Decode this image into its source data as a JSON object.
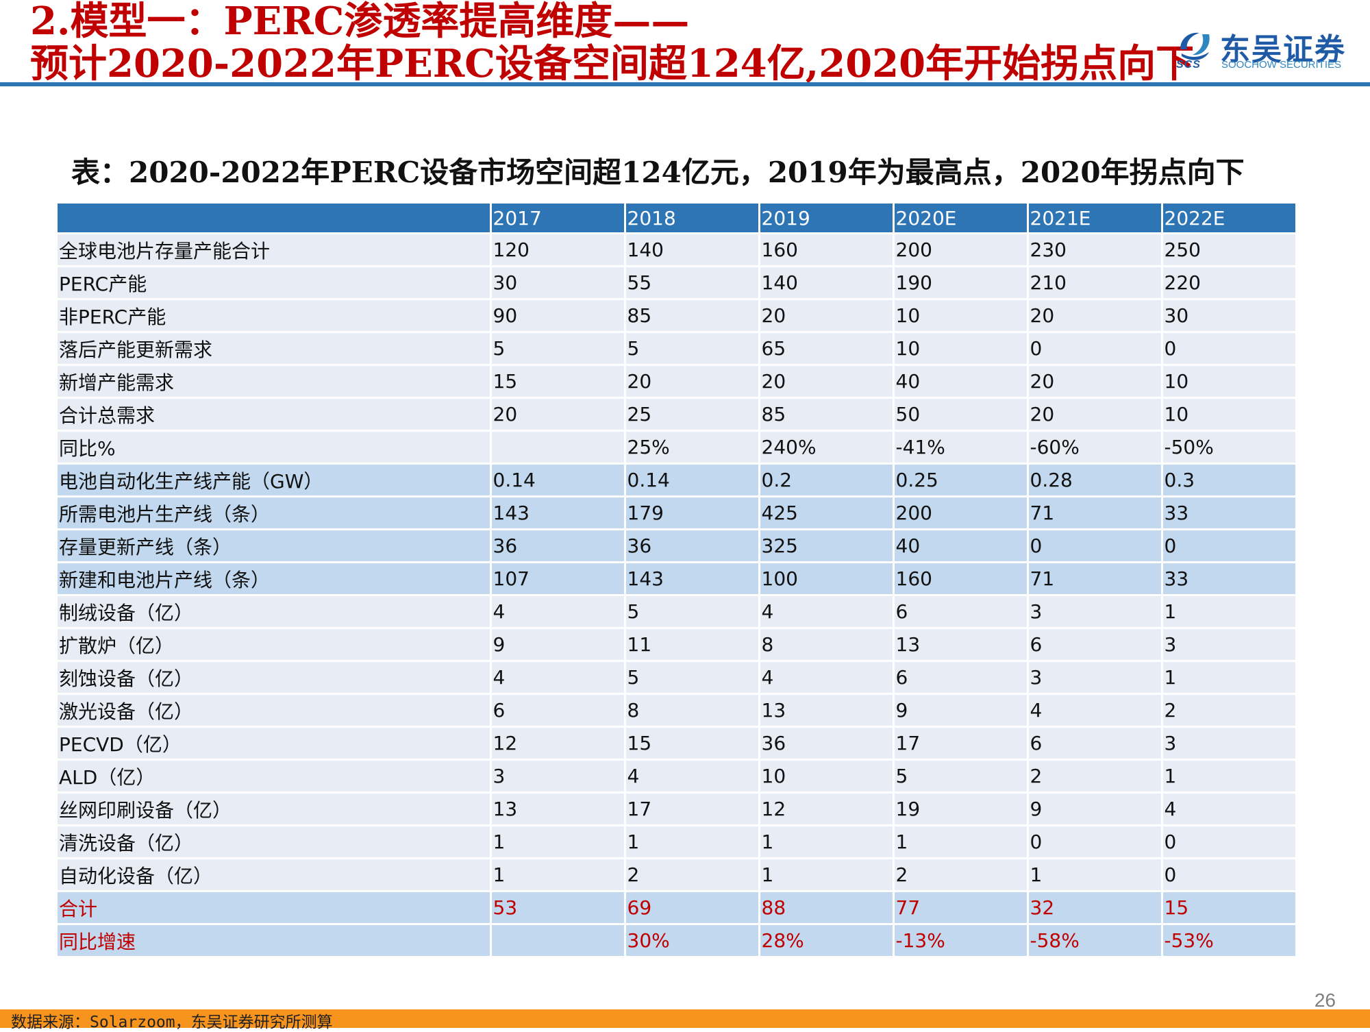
{
  "header": {
    "title_line1": "2.模型一：PERC渗透率提高维度——",
    "title_line2": "预计2020-2022年PERC设备空间超124亿,2020年开始拐点向下"
  },
  "logo": {
    "name_cn": "东吴证券",
    "name_en": "SOOCHOW SECURITIES",
    "abbr": "SCS",
    "brand_color": "#1f5aa6"
  },
  "table_title": "表：2020-2022年PERC设备市场空间超124亿元，2019年为最高点，2020年拐点向下",
  "table": {
    "header": [
      "",
      "2017",
      "2018",
      "2019",
      "2020E",
      "2021E",
      "2022E"
    ],
    "rows": [
      {
        "style": "light",
        "cells": [
          "全球电池片存量产能合计",
          "120",
          "140",
          "160",
          "200",
          "230",
          "250"
        ]
      },
      {
        "style": "light",
        "cells": [
          "PERC产能",
          "30",
          "55",
          "140",
          "190",
          "210",
          "220"
        ]
      },
      {
        "style": "light",
        "cells": [
          "非PERC产能",
          "90",
          "85",
          "20",
          "10",
          "20",
          "30"
        ]
      },
      {
        "style": "light",
        "cells": [
          "落后产能更新需求",
          "5",
          "5",
          "65",
          "10",
          "0",
          "0"
        ]
      },
      {
        "style": "light",
        "cells": [
          "新增产能需求",
          "15",
          "20",
          "20",
          "40",
          "20",
          "10"
        ]
      },
      {
        "style": "light",
        "cells": [
          "合计总需求",
          "20",
          "25",
          "85",
          "50",
          "20",
          "10"
        ]
      },
      {
        "style": "light",
        "cells": [
          "同比%",
          "",
          "25%",
          "240%",
          "-41%",
          "-60%",
          "-50%"
        ]
      },
      {
        "style": "blue",
        "cells": [
          "电池自动化生产线产能（GW）",
          "0.14",
          "0.14",
          "0.2",
          "0.25",
          "0.28",
          "0.3"
        ]
      },
      {
        "style": "blue",
        "cells": [
          "所需电池片生产线（条）",
          "143",
          "179",
          "425",
          "200",
          "71",
          "33"
        ]
      },
      {
        "style": "blue",
        "cells": [
          "存量更新产线（条）",
          "36",
          "36",
          "325",
          "40",
          "0",
          "0"
        ]
      },
      {
        "style": "blue",
        "cells": [
          "新建和电池片产线（条）",
          "107",
          "143",
          "100",
          "160",
          "71",
          "33"
        ]
      },
      {
        "style": "light",
        "cells": [
          "制绒设备（亿）",
          "4",
          "5",
          "4",
          "6",
          "3",
          "1"
        ]
      },
      {
        "style": "light",
        "cells": [
          "扩散炉（亿）",
          "9",
          "11",
          "8",
          "13",
          "6",
          "3"
        ]
      },
      {
        "style": "light",
        "cells": [
          "刻蚀设备（亿）",
          "4",
          "5",
          "4",
          "6",
          "3",
          "1"
        ]
      },
      {
        "style": "light",
        "cells": [
          "激光设备（亿）",
          "6",
          "8",
          "13",
          "9",
          "4",
          "2"
        ]
      },
      {
        "style": "light",
        "cells": [
          "PECVD（亿）",
          "12",
          "15",
          "36",
          "17",
          "6",
          "3"
        ]
      },
      {
        "style": "light",
        "cells": [
          "ALD（亿）",
          "3",
          "4",
          "10",
          "5",
          "2",
          "1"
        ]
      },
      {
        "style": "light",
        "cells": [
          "丝网印刷设备（亿）",
          "13",
          "17",
          "12",
          "19",
          "9",
          "4"
        ]
      },
      {
        "style": "light",
        "cells": [
          "清洗设备（亿）",
          "1",
          "1",
          "1",
          "1",
          "0",
          "0"
        ]
      },
      {
        "style": "light",
        "cells": [
          "自动化设备（亿）",
          "1",
          "2",
          "1",
          "2",
          "1",
          "0"
        ]
      },
      {
        "style": "blue total",
        "cells": [
          "合计",
          "53",
          "69",
          "88",
          "77",
          "32",
          "15"
        ]
      },
      {
        "style": "blue total",
        "cells": [
          "同比增速",
          "",
          "30%",
          "28%",
          "-13%",
          "-58%",
          "-53%"
        ]
      }
    ]
  },
  "page_number": "26",
  "footer_source": "数据来源：Solarzoom，东吴证券研究所测算",
  "colors": {
    "title_red": "#c00000",
    "header_blue": "#2e75b6",
    "row_light": "#e8ecf5",
    "row_blue": "#c1d8ee",
    "footer_orange": "#f7941d"
  }
}
